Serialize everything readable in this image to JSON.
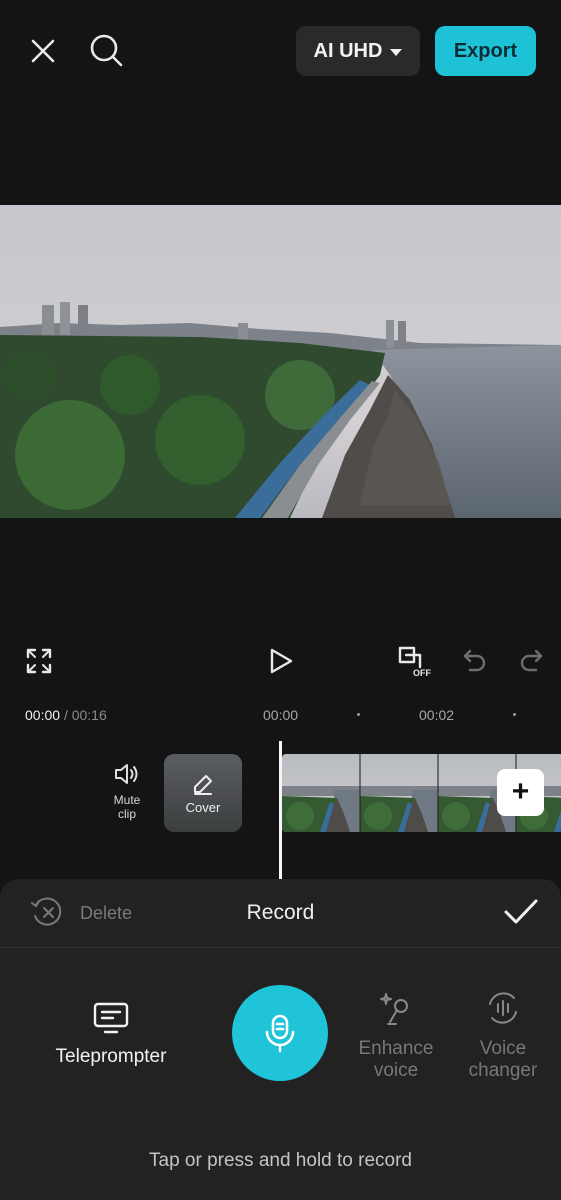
{
  "top_bar": {
    "quality_label": "AI UHD",
    "export_label": "Export"
  },
  "timeline": {
    "current_time": "00:00",
    "total_time": "/ 00:16",
    "tick_0": "00:00",
    "tick_1": "00:02"
  },
  "track": {
    "mute_label_line1": "Mute",
    "mute_label_line2": "clip",
    "cover_label": "Cover",
    "add_label": "+"
  },
  "record_panel": {
    "delete_label": "Delete",
    "title": "Record",
    "teleprompter_label": "Teleprompter",
    "enhance_line1": "Enhance",
    "enhance_line2": "voice",
    "voice_changer_line1": "Voice",
    "voice_changer_line2": "changer",
    "hint": "Tap or press and hold to record"
  },
  "colors": {
    "accent": "#1ec2d6",
    "background": "#141414",
    "panel": "#222222"
  },
  "icons": [
    "close-icon",
    "search-icon",
    "fullscreen-icon",
    "play-icon",
    "keyframe-off-icon",
    "undo-icon",
    "redo-icon",
    "speaker-icon",
    "pencil-icon",
    "delete-icon",
    "checkmark-icon",
    "teleprompter-icon",
    "microphone-icon",
    "enhance-voice-icon",
    "voice-changer-icon"
  ]
}
